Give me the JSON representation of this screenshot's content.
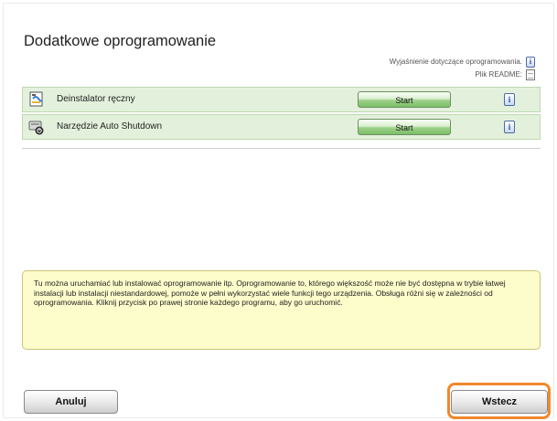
{
  "window": {
    "title": "Dodatkowe oprogramowanie"
  },
  "info_links": {
    "explanation_label": "Wyjaśnienie dotyczące oprogramowania.",
    "readme_label": "Plik README:"
  },
  "software": [
    {
      "label": "Deinstalator ręczny",
      "button": "Start",
      "icon": "uninstaller-icon"
    },
    {
      "label": "Narzędzie Auto Shutdown",
      "button": "Start",
      "icon": "auto-shutdown-icon"
    }
  ],
  "note": {
    "text": "Tu można uruchamiać lub instalować oprogramowanie itp. Oprogramowanie to, którego większość może nie być dostępna w trybie łatwej instalacji lub instalacji niestandardowej, pomoże w pełni wykorzystać wiele funkcji tego urządzenia. Obsługa różni się w zależności od oprogramowania. Kliknij przycisk po prawej stronie każdego programu, aby go uruchomić."
  },
  "buttons": {
    "cancel": "Anuluj",
    "back": "Wstecz"
  },
  "colors": {
    "row_bg": "#e3f1dc",
    "note_bg": "#fdfccb",
    "focus_ring": "#f1882b"
  }
}
